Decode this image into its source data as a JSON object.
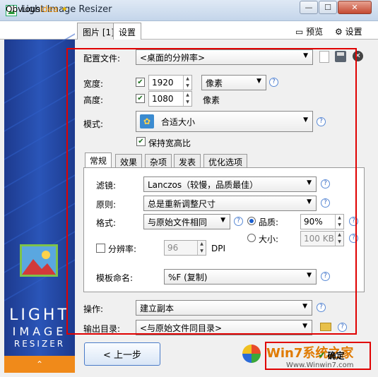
{
  "window": {
    "title": "Light Image Resizer",
    "btn_min": "—",
    "btn_max": "☐",
    "btn_close": "✕"
  },
  "header": {
    "brand_a": "Obvious",
    "brand_b": "idea",
    "tab_images": "图片 [1]",
    "tab_settings": "设置",
    "preview": "预览",
    "settings": "设置"
  },
  "sidebar": {
    "line1": "LIGHT",
    "line2": "IMAGE",
    "line3": "RESIZER",
    "collapse": "⌃"
  },
  "profile": {
    "label": "配置文件:",
    "value": "<桌面的分辨率>"
  },
  "width": {
    "label": "宽度:",
    "value": "1920",
    "unit": "像素"
  },
  "height": {
    "label": "高度:",
    "value": "1080",
    "unit": "像素"
  },
  "mode": {
    "label": "模式:",
    "value": "合适大小",
    "keep_ratio": "保持宽高比"
  },
  "tabs": [
    "常规",
    "效果",
    "杂项",
    "发表",
    "优化选项"
  ],
  "general": {
    "filter_label": "滤镜:",
    "filter_value": "Lanczos（较慢，品质最佳）",
    "principle_label": "原则:",
    "principle_value": "总是重新调整尺寸",
    "format_label": "格式:",
    "format_value": "与原始文件相同",
    "quality_label": "品质:",
    "quality_value": "90%",
    "size_label": "大小:",
    "size_value": "100 KB",
    "resolution_label": "分辨率:",
    "resolution_value": "96",
    "dpi": "DPI",
    "naming_label": "模板命名:",
    "naming_value": "%F (复制)"
  },
  "action": {
    "label": "操作:",
    "value": "建立副本"
  },
  "output": {
    "label": "输出目录:",
    "value": "<与原始文件同目录>"
  },
  "buttons": {
    "prev": "< 上一步",
    "ok": "确定"
  },
  "watermark": {
    "text": "Win7系统之家",
    "url": "Www.Winwin7.com"
  },
  "help_glyph": "?",
  "colors": {
    "highlight": "#e00000",
    "sidebar": "#2a55b8",
    "accent_orange": "#f08a1a"
  }
}
